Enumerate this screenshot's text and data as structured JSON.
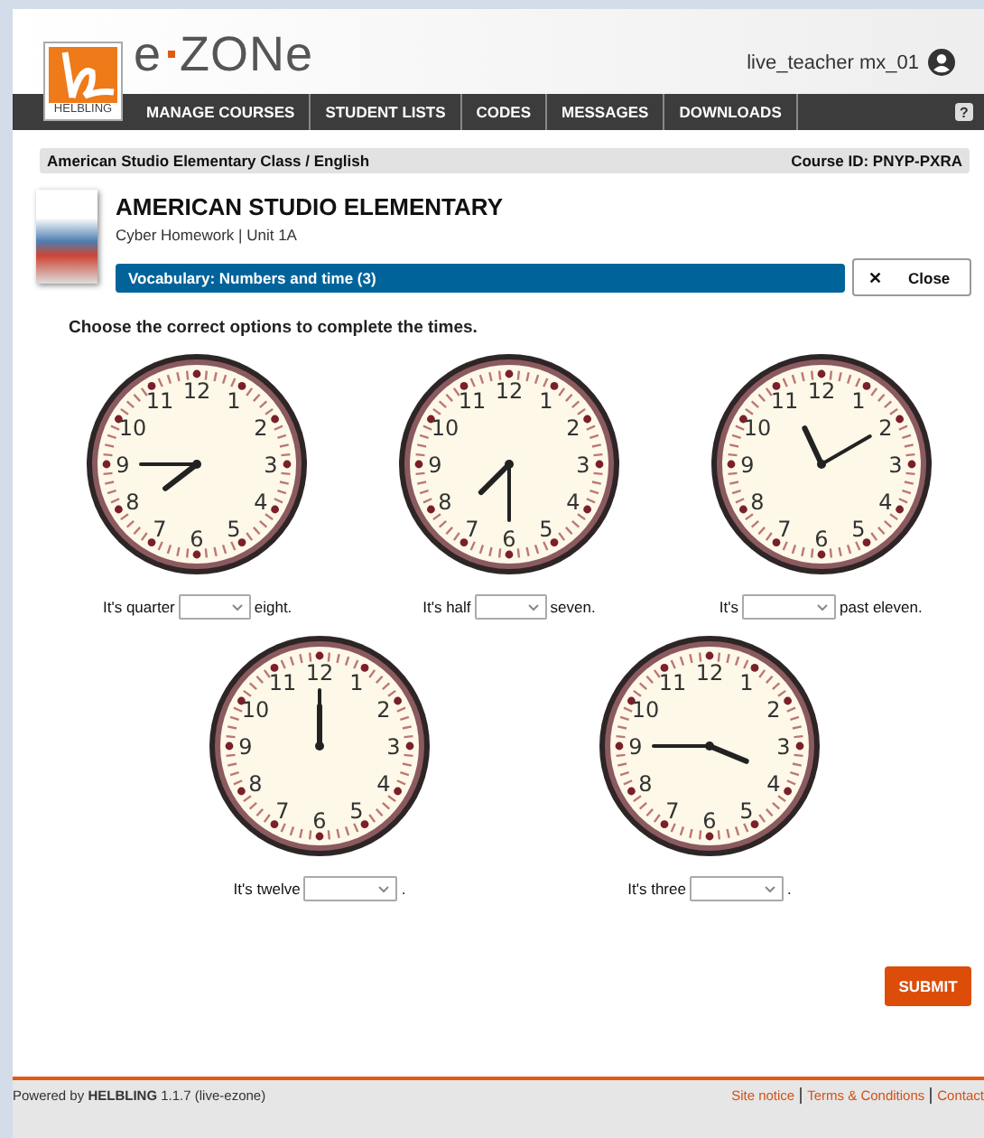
{
  "header": {
    "logo_caption": "HELBLING",
    "brand_prefix": "e",
    "brand_suffix": "ZONe",
    "user": "live_teacher mx_01"
  },
  "nav": {
    "items": [
      "MANAGE COURSES",
      "STUDENT LISTS",
      "CODES",
      "MESSAGES",
      "DOWNLOADS"
    ],
    "help": "?"
  },
  "breadcrumb": {
    "path": "American Studio Elementary Class / English",
    "course_id": "Course ID: PNYP-PXRA"
  },
  "course": {
    "title": "AMERICAN STUDIO ELEMENTARY",
    "subtitle": "Cyber Homework | Unit 1A",
    "exercise": "Vocabulary: Numbers and time (3)",
    "close_icon": "✕",
    "close": "Close"
  },
  "instruction": "Choose the correct options to complete the times.",
  "rows": [
    [
      {
        "numerals": [
          "12",
          "11",
          "1",
          "10",
          "2",
          "9",
          "3",
          "8",
          "4",
          "7",
          "5",
          "6"
        ],
        "before": "It's quarter",
        "after": "eight."
      },
      {
        "numerals": [
          "12",
          "11",
          "1",
          "10",
          "2",
          "9",
          "3",
          "8",
          "4",
          "7",
          "5",
          "6"
        ],
        "before": "It's half",
        "after": "seven."
      },
      {
        "numerals": [
          "12",
          "11",
          "1",
          "10",
          "2",
          "9",
          "3",
          "8",
          "4",
          "7",
          "5",
          "6"
        ],
        "before": "It's",
        "after": "past eleven."
      }
    ],
    [
      {
        "numerals": [
          "12",
          "11",
          "1",
          "10",
          "2",
          "9",
          "3",
          "8",
          "4",
          "7",
          "5",
          "6"
        ],
        "before": "It's twelve",
        "after": "."
      },
      {
        "numerals": [
          "12",
          "11",
          "1",
          "10",
          "2",
          "9",
          "3",
          "8",
          "4",
          "7",
          "5",
          "6"
        ],
        "before": "It's three",
        "after": "."
      }
    ]
  ],
  "submit": "SUBMIT",
  "footer": {
    "powered": "Powered by **HELBLING** 1.1.7 (live-ezone)",
    "links": [
      "Site notice",
      "Terms & Conditions",
      "Contact"
    ]
  }
}
